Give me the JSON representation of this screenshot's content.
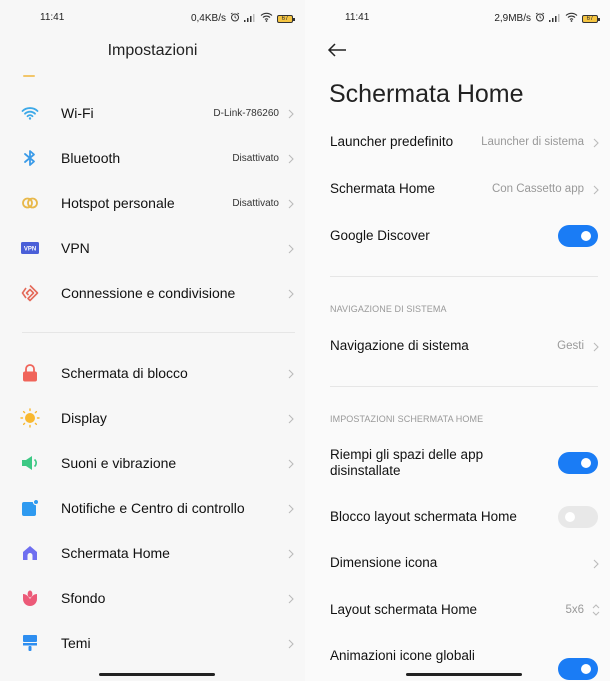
{
  "left": {
    "status": {
      "time": "11:41",
      "speed": "0,4KB/s",
      "battery": "67"
    },
    "title": "Impostazioni",
    "items": [
      {
        "label": "Wi-Fi",
        "value": "D-Link-786260",
        "icon": "wifi-icon",
        "color": "#3da9e8"
      },
      {
        "label": "Bluetooth",
        "value": "Disattivato",
        "icon": "bluetooth-icon",
        "color": "#3b9be8"
      },
      {
        "label": "Hotspot personale",
        "value": "Disattivato",
        "icon": "hotspot-icon",
        "color": "#e8b84a"
      },
      {
        "label": "VPN",
        "value": "",
        "icon": "vpn-icon",
        "color": "#4a5fd8"
      },
      {
        "label": "Connessione e condivisione",
        "value": "",
        "icon": "connection-sharing-icon",
        "color": "#e46a5a"
      },
      {
        "label": "Schermata di blocco",
        "value": "",
        "icon": "lock-icon",
        "color": "#f0645a"
      },
      {
        "label": "Display",
        "value": "",
        "icon": "sun-icon",
        "color": "#f8b830"
      },
      {
        "label": "Suoni e vibrazione",
        "value": "",
        "icon": "speaker-icon",
        "color": "#3cc884"
      },
      {
        "label": "Notifiche e Centro di controllo",
        "value": "",
        "icon": "notification-icon",
        "color": "#2e9af0"
      },
      {
        "label": "Schermata Home",
        "value": "",
        "icon": "home-icon",
        "color": "#6e6ef0"
      },
      {
        "label": "Sfondo",
        "value": "",
        "icon": "flower-icon",
        "color": "#ec5a78"
      },
      {
        "label": "Temi",
        "value": "",
        "icon": "brush-icon",
        "color": "#2e8ef0"
      }
    ]
  },
  "right": {
    "status": {
      "time": "11:41",
      "speed": "2,9MB/s",
      "battery": "67"
    },
    "title": "Schermata Home",
    "rows": {
      "launcher": {
        "label": "Launcher predefinito",
        "value": "Launcher di sistema"
      },
      "home": {
        "label": "Schermata Home",
        "value": "Con Cassetto app"
      },
      "discover": {
        "label": "Google Discover",
        "on": true
      },
      "nav_section": "NAVIGAZIONE DI SISTEMA",
      "nav": {
        "label": "Navigazione di sistema",
        "value": "Gesti"
      },
      "home_section": "IMPOSTAZIONI SCHERMATA HOME",
      "fill_line1": "Riempi gli spazi delle app",
      "fill_line2": "disinstallate",
      "fill_on": true,
      "lock_layout": {
        "label": "Blocco layout schermata Home",
        "on": false
      },
      "icon_size": {
        "label": "Dimensione icona"
      },
      "layout": {
        "label": "Layout schermata Home",
        "value": "5x6"
      },
      "animations": {
        "label": "Animazioni icone globali",
        "on": true
      }
    }
  },
  "colors": {
    "accent": "#1a7cf5"
  }
}
